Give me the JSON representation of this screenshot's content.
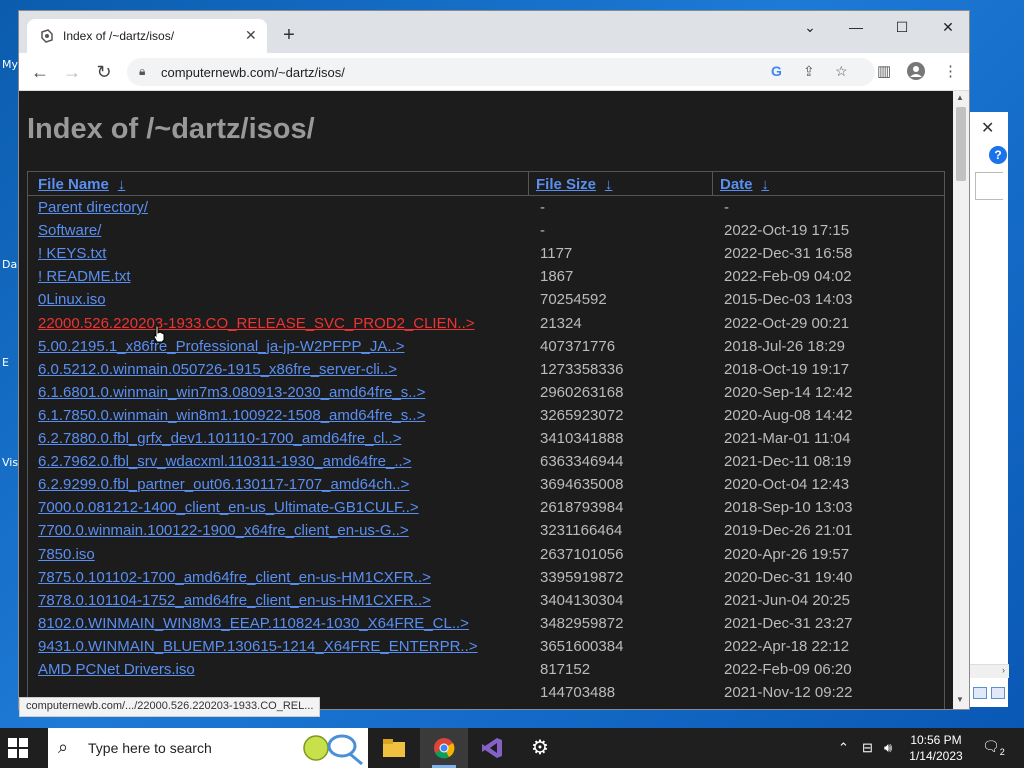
{
  "desktop": {
    "labels": [
      "My",
      "Da",
      "E",
      "Vis"
    ]
  },
  "browser": {
    "tab_title": "Index of /~dartz/isos/",
    "address": "computernewb.com/~dartz/isos/",
    "status_url": "computernewb.com/.../22000.526.220203-1933.CO_REL..."
  },
  "page": {
    "heading": "Index of /~dartz/isos/",
    "columns": {
      "name": "File Name",
      "size": "File Size",
      "date": "Date",
      "sort_arrow": "↓"
    },
    "rows": [
      {
        "name": "Parent directory/",
        "size": "-",
        "date": "-"
      },
      {
        "name": "Software/",
        "size": "-",
        "date": "2022-Oct-19 17:15"
      },
      {
        "name": "! KEYS.txt",
        "size": "1177",
        "date": "2022-Dec-31 16:58"
      },
      {
        "name": "! README.txt",
        "size": "1867",
        "date": "2022-Feb-09 04:02"
      },
      {
        "name": "0Linux.iso",
        "size": "70254592",
        "date": "2015-Dec-03 14:03"
      },
      {
        "name": "22000.526.220203-1933.CO_RELEASE_SVC_PROD2_CLIEN..>",
        "size": "21324",
        "date": "2022-Oct-29 00:21"
      },
      {
        "name": "5.00.2195.1_x86fre_Professional_ja-jp-W2PFPP_JA..>",
        "size": "407371776",
        "date": "2018-Jul-26 18:29"
      },
      {
        "name": "6.0.5212.0.winmain.050726-1915_x86fre_server-cli..>",
        "size": "1273358336",
        "date": "2018-Oct-19 19:17"
      },
      {
        "name": "6.1.6801.0.winmain_win7m3.080913-2030_amd64fre_s..>",
        "size": "2960263168",
        "date": "2020-Sep-14 12:42"
      },
      {
        "name": "6.1.7850.0.winmain_win8m1.100922-1508_amd64fre_s..>",
        "size": "3265923072",
        "date": "2020-Aug-08 14:42"
      },
      {
        "name": "6.2.7880.0.fbl_grfx_dev1.101110-1700_amd64fre_cl..>",
        "size": "3410341888",
        "date": "2021-Mar-01 11:04"
      },
      {
        "name": "6.2.7962.0.fbl_srv_wdacxml.110311-1930_amd64fre_..>",
        "size": "6363346944",
        "date": "2021-Dec-11 08:19"
      },
      {
        "name": "6.2.9299.0.fbl_partner_out06.130117-1707_amd64ch..>",
        "size": "3694635008",
        "date": "2020-Oct-04 12:43"
      },
      {
        "name": "7000.0.081212-1400_client_en-us_Ultimate-GB1CULF..>",
        "size": "2618793984",
        "date": "2018-Sep-10 13:03"
      },
      {
        "name": "7700.0.winmain.100122-1900_x64fre_client_en-us-G..>",
        "size": "3231166464",
        "date": "2019-Dec-26 21:01"
      },
      {
        "name": "7850.iso",
        "size": "2637101056",
        "date": "2020-Apr-26 19:57"
      },
      {
        "name": "7875.0.101102-1700_amd64fre_client_en-us-HM1CXFR..>",
        "size": "3395919872",
        "date": "2020-Dec-31 19:40"
      },
      {
        "name": "7878.0.101104-1752_amd64fre_client_en-us-HM1CXFR..>",
        "size": "3404130304",
        "date": "2021-Jun-04 20:25"
      },
      {
        "name": "8102.0.WINMAIN_WIN8M3_EEAP.110824-1030_X64FRE_CL..>",
        "size": "3482959872",
        "date": "2021-Dec-31 23:27"
      },
      {
        "name": "9431.0.WINMAIN_BLUEMP.130615-1214_X64FRE_ENTERPR..>",
        "size": "3651600384",
        "date": "2022-Apr-18 22:12"
      },
      {
        "name": "AMD PCNet Drivers.iso",
        "size": "817152",
        "date": "2022-Feb-09 06:20"
      },
      {
        "name": "",
        "size": "144703488",
        "date": "2021-Nov-12 09:22"
      }
    ],
    "hover_row_index": 5
  },
  "taskbar": {
    "search_placeholder": "Type here to search",
    "time": "10:56 PM",
    "date": "1/14/2023",
    "notification_count": "2"
  },
  "colors": {
    "link": "#5a8ff2",
    "link_hover": "#e33333",
    "page_bg": "#1c1c1c"
  }
}
